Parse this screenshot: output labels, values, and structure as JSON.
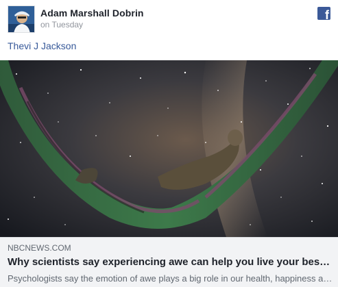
{
  "post": {
    "author_name": "Adam Marshall Dobrin",
    "time": "on Tuesday",
    "mention": "Thevi J Jackson",
    "avatar_icon": "user-avatar",
    "network_icon": "facebook-icon"
  },
  "link": {
    "domain": "NBCNEWS.COM",
    "title": "Why scientists say experiencing awe can help you live your best life",
    "description": "Psychologists say the emotion of awe plays a big role in our health, happiness and well-being."
  },
  "colors": {
    "link_blue": "#365899",
    "facebook_blue": "#3b5998",
    "card_bg": "#f2f3f5"
  }
}
